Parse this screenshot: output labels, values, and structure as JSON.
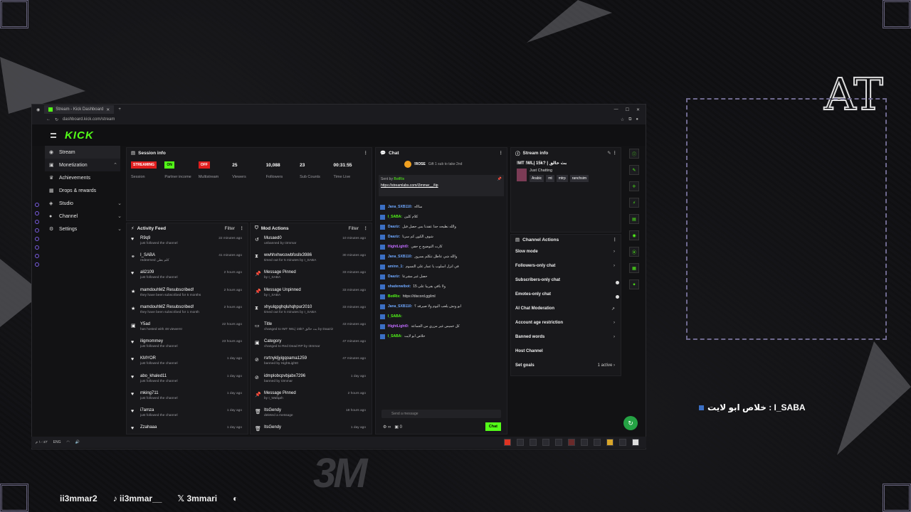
{
  "browser": {
    "tab_title": "Stream - Kick Dashboard",
    "url": "dashboard.kick.com/stream"
  },
  "logo": "KICK",
  "sidebar": {
    "items": [
      {
        "label": "Stream",
        "icon": "stream-icon"
      },
      {
        "label": "Monetization",
        "icon": "money-icon"
      },
      {
        "label": "Achievements",
        "icon": "trophy-icon"
      },
      {
        "label": "Drops & rewards",
        "icon": "gift-icon"
      },
      {
        "label": "Studio",
        "icon": "studio-icon"
      },
      {
        "label": "Channel",
        "icon": "person-icon"
      },
      {
        "label": "Settings",
        "icon": "gear-icon"
      }
    ]
  },
  "session_info": {
    "title": "Session info",
    "stats": [
      {
        "value": "STREAMING",
        "label": "Session"
      },
      {
        "value": "ON",
        "label": "Partner income"
      },
      {
        "value": "OFF",
        "label": "Multistream"
      },
      {
        "value": "25",
        "label": "Viewers"
      },
      {
        "value": "10,088",
        "label": "Followers"
      },
      {
        "value": "23",
        "label": "Sub Counts"
      },
      {
        "value": "00:31:55",
        "label": "Time Live"
      }
    ]
  },
  "activity_feed": {
    "title": "Activity Feed",
    "filter": "Filter",
    "rows": [
      {
        "name": "R9q9",
        "desc": "just followed the channel",
        "time": "22 minutes ago"
      },
      {
        "name": "I_SABA",
        "desc": "redeemed كلم بطي",
        "time": "41 minutes ago"
      },
      {
        "name": "ali2109",
        "desc": "just followed the channel",
        "time": "2 hours ago"
      },
      {
        "name": "mamdouhMZ Resubscribed!",
        "desc": "they have been subscribed for 5 months",
        "time": "2 hours ago"
      },
      {
        "name": "mamdouhMZ Resubscribed!",
        "desc": "they have been subscribed for 1 month",
        "time": "2 hours ago"
      },
      {
        "name": "Y5ad",
        "desc": "has hosted with 48 viewers!",
        "time": "22 hours ago"
      },
      {
        "name": "iligmommey",
        "desc": "just followed the channel",
        "time": "23 hours ago"
      },
      {
        "name": "KMYOR",
        "desc": "just followed the channel",
        "time": "1 day ago"
      },
      {
        "name": "abo_khaled11",
        "desc": "just followed the channel",
        "time": "1 day ago"
      },
      {
        "name": "mking711",
        "desc": "just followed the channel",
        "time": "1 day ago"
      },
      {
        "name": "i7amza",
        "desc": "just followed the channel",
        "time": "1 day ago"
      },
      {
        "name": "Zzahaaa",
        "desc": "",
        "time": "1 day ago"
      }
    ]
  },
  "mod_actions": {
    "title": "Mod Actions",
    "filter": "Filter",
    "rows": [
      {
        "name": "Musaed0",
        "desc": "unbanned by I3mmar",
        "time": "10 minutes ago"
      },
      {
        "name": "wwhhxhwcowbfosllx3986",
        "desc": "timed out for 5 minutes by I_SABA",
        "time": "30 minutes ago"
      },
      {
        "name": "Message Pinned",
        "desc": "by I_SABA",
        "time": "33 minutes ago"
      },
      {
        "name": "Message Unpinned",
        "desc": "by I_SABA",
        "time": "33 minutes ago"
      },
      {
        "name": "xhyulqpghqluhqhpur2010",
        "desc": "timed out for 5 minutes by I_SABA",
        "time": "33 minutes ago"
      },
      {
        "name": "Title",
        "desc": "changed to !MT !WL| 15k? بث خالق by Daaziz",
        "time": "43 minutes ago"
      },
      {
        "name": "Category",
        "desc": "changed to Red Dead RP by I3mmar",
        "time": "47 minutes ago"
      },
      {
        "name": "rsrtnykljyigqoama1259",
        "desc": "banned by HightLight0",
        "time": "47 minutes ago"
      },
      {
        "name": "idmplobcpvbjabx7296",
        "desc": "banned by I3mmar",
        "time": "1 day ago"
      },
      {
        "name": "Message Pinned",
        "desc": "by I_Wafqah",
        "time": "2 hours ago"
      },
      {
        "name": "ItsGendy",
        "desc": "deleted a message",
        "time": "18 hours ago"
      },
      {
        "name": "ItsGendy",
        "desc": "",
        "time": "1 day ago"
      }
    ]
  },
  "chat": {
    "title": "Chat",
    "gift_user": "!ROSE",
    "gift_text": "Gift 1 sub to take 2nd",
    "pinned_sender": "BotRix",
    "pinned_text": "https://streamlabs.com/i3mmar__/tip",
    "messages": [
      {
        "user": "Jana_SXB110:",
        "text": "ساااه",
        "color": "#6fa8ff"
      },
      {
        "user": "I_SABA:",
        "text": "كلام كلين",
        "color": "#53fc18"
      },
      {
        "user": "Daaziz:",
        "text": "والله نطيحه جدا عقدنا بس حصل فيل",
        "color": "#6fa8ff"
      },
      {
        "user": "Daaziz:",
        "text": "شوف الكون كم سرنا",
        "color": "#6fa8ff"
      },
      {
        "user": "HightLight0:",
        "text": "كارت التوضيح ح حقي",
        "color": "#c06bff"
      },
      {
        "user": "Jana_SXB110:",
        "text": "والله شي عاطل تتكلم بسرور",
        "color": "#6fa8ff"
      },
      {
        "user": "aminn_1:",
        "text": "في انزل اسلوب يا عمار على التسوم",
        "color": "#6fa8ff"
      },
      {
        "user": "Daaziz:",
        "text": "حصل غير مشرعا",
        "color": "#6fa8ff"
      },
      {
        "user": "shadenwibot:",
        "text": "ولا باقي بقريبا على 15",
        "color": "#6fa8ff"
      },
      {
        "user": "BotRix:",
        "text": "https://discord.gg/iml",
        "color": "#53fc18"
      },
      {
        "user": "Jana_SXB110:",
        "text": "ابو ونش يلعب اليوم ولا صيرفه ؟",
        "color": "#6fa8ff"
      },
      {
        "user": "I_SABA:",
        "text": "",
        "color": "#53fc18"
      },
      {
        "user": "HightLight0:",
        "text": "كل خميس غير مزري من الجماعة",
        "color": "#c06bff"
      },
      {
        "user": "I_SABA:",
        "text": "خلاص ابو لايت",
        "color": "#53fc18"
      }
    ],
    "input_placeholder": "Send a message",
    "viewer_count": "0",
    "send_label": "Chat"
  },
  "stream_info": {
    "title": "Stream info",
    "stream_title": "!MT !WL| 15k? | بث خالق",
    "category": "Just Chatting",
    "tags": [
      "Arabic",
      "mt",
      "mtrp",
      "ranchsim"
    ]
  },
  "channel_actions": {
    "title": "Channel Actions",
    "rows": [
      {
        "label": "Slow mode",
        "right": "›"
      },
      {
        "label": "Followers-only chat",
        "right": "›"
      },
      {
        "label": "Subscribers-only chat",
        "right": "toggle"
      },
      {
        "label": "Emotes-only chat",
        "right": "toggle"
      },
      {
        "label": "AI Chat Moderation",
        "right": "↗"
      },
      {
        "label": "Account age restriction",
        "right": "›"
      },
      {
        "label": "Banned words",
        "right": "›"
      },
      {
        "label": "Host Channel",
        "right": ""
      },
      {
        "label": "Set goals",
        "right": "1 active ›"
      }
    ]
  },
  "taskbar": {
    "lang": "ENG",
    "time": "١٠:٤٢ م"
  },
  "overlay": {
    "chat_line": "خلاص ابو لايت : I_SABA"
  },
  "brand_footer": [
    "ii3mmar2",
    "ii3mmar__",
    "3mmari"
  ],
  "watermark": "3M",
  "corner_logo": "AT",
  "colors": {
    "accent": "#53fc18",
    "streaming": "#e01e1e"
  }
}
